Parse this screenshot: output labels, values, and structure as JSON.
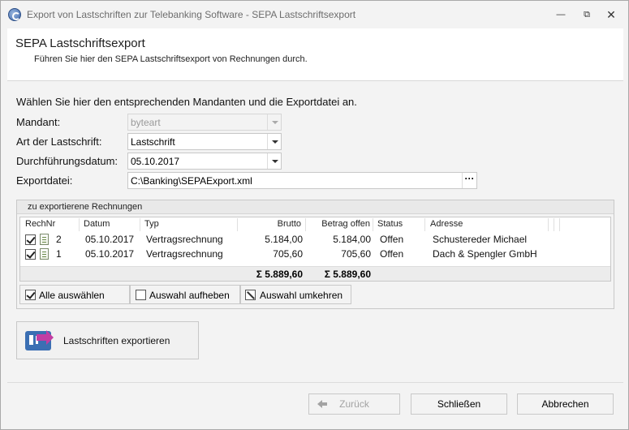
{
  "window": {
    "title": "Export von Lastschriften zur Telebanking Software - SEPA Lastschriftsexport",
    "icons": {
      "app": "app-logo-icon",
      "minimize": "minimize-icon",
      "maximize": "maximize-icon",
      "close": "close-icon"
    }
  },
  "header": {
    "title": "SEPA Lastschriftsexport",
    "subtitle": "Führen Sie hier den SEPA Lastschriftsexport von Rechnungen durch."
  },
  "form": {
    "intro": "Wählen Sie hier den entsprechenden Mandanten und die Exportdatei an.",
    "mandant_label": "Mandant:",
    "mandant_value": "byteart",
    "art_label": "Art der Lastschrift:",
    "art_value": "Lastschrift",
    "datum_label": "Durchführungsdatum:",
    "datum_value": "05.10.2017",
    "export_label": "Exportdatei:",
    "export_value": "C:\\Banking\\SEPAExport.xml",
    "browse_label": "···"
  },
  "group": {
    "title": "zu exportierene Rechnungen",
    "columns": {
      "rechnr": "RechNr",
      "datum": "Datum",
      "typ": "Typ",
      "brutto": "Brutto",
      "betrag_offen": "Betrag offen",
      "status": "Status",
      "adresse": "Adresse"
    },
    "rows": [
      {
        "checked": true,
        "nr": "2",
        "datum": "05.10.2017",
        "typ": "Vertragsrechnung",
        "brutto": "5.184,00",
        "offen": "5.184,00",
        "status": "Offen",
        "adresse": "Schustereder Michael"
      },
      {
        "checked": true,
        "nr": "1",
        "datum": "05.10.2017",
        "typ": "Vertragsrechnung",
        "brutto": "705,60",
        "offen": "705,60",
        "status": "Offen",
        "adresse": "Dach & Spengler GmbH"
      }
    ],
    "sum_brutto": "Σ 5.889,60",
    "sum_offen": "Σ 5.889,60",
    "buttons": {
      "select_all": "Alle auswählen",
      "select_all_checked": true,
      "deselect": "Auswahl aufheben",
      "invert": "Auswahl umkehren"
    }
  },
  "export_button": {
    "label": "Lastschriften exportieren",
    "icon": "export-card-icon"
  },
  "footer": {
    "back": "Zurück",
    "close": "Schließen",
    "cancel": "Abbrechen"
  }
}
